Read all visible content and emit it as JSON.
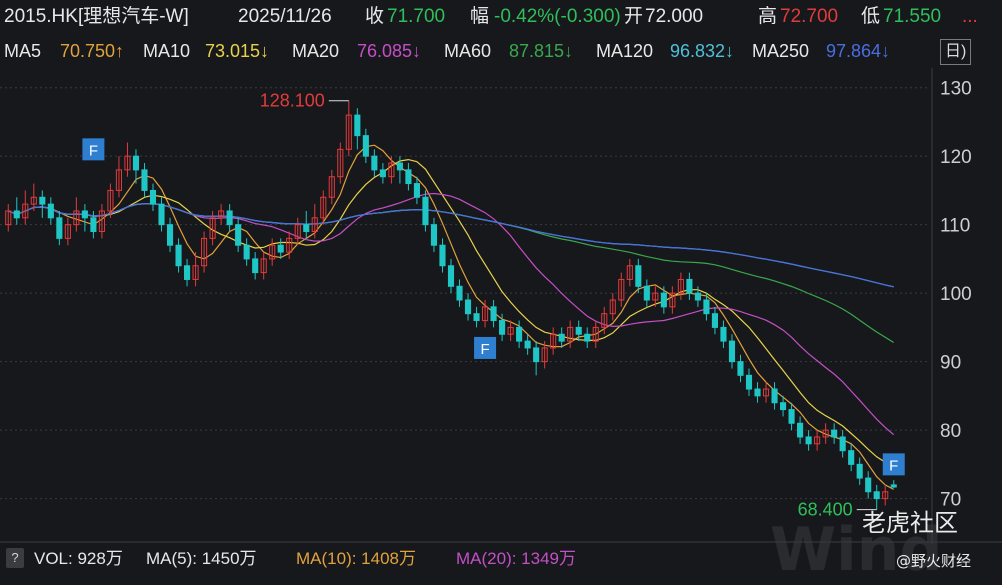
{
  "header": {
    "symbol": "2015.HK[理想汽车-W]",
    "date": "2025/11/26",
    "close_label": "收",
    "close": "71.700",
    "change_label": "幅",
    "change": "-0.42%(-0.300)",
    "open_label": "开",
    "open": "72.000",
    "high_label": "高",
    "high": "72.700",
    "low_label": "低",
    "low": "71.550",
    "more": "..."
  },
  "ma_row": [
    {
      "text": "MA5",
      "value": "70.750↑",
      "color": "#e1a23c"
    },
    {
      "text": "MA10",
      "value": "73.015↓",
      "color": "#e8d24a"
    },
    {
      "text": "MA20",
      "value": "76.085↓",
      "color": "#c44fc6"
    },
    {
      "text": "MA60",
      "value": "87.815↓",
      "color": "#39a74c"
    },
    {
      "text": "MA120",
      "value": "96.832↓",
      "color": "#4fc0d8"
    },
    {
      "text": "MA250",
      "value": "97.864↓",
      "color": "#4a6ee0"
    }
  ],
  "period_button": "日)",
  "volume_row": {
    "icon": "?",
    "vol": "VOL: 928万",
    "ma5": "MA(5): 1450万",
    "ma10": "MA(10): 1408万",
    "ma20": "MA(20): 1349万"
  },
  "watermark": {
    "brand": "老虎社区",
    "author": "@野火财经",
    "bg_text": "Wind"
  },
  "colors": {
    "up": "#e23b3b",
    "down": "#1fc6c6",
    "axis_text": "#cfcfcf",
    "grid": "#3a3b40",
    "high_label": "#e23b3b",
    "low_label": "#2fbf5a",
    "flag": "#2f7fd0"
  },
  "chart_data": {
    "type": "candlestick",
    "yticks": [
      70,
      80,
      90,
      100,
      110,
      120,
      130
    ],
    "ylim": [
      66,
      132
    ],
    "annotations": {
      "high": "128.100",
      "low": "68.400",
      "event_flag": "F"
    },
    "candles": [
      [
        110,
        112,
        109,
        113
      ],
      [
        112,
        111,
        110,
        114
      ],
      [
        111,
        113,
        110,
        115
      ],
      [
        113,
        114,
        112,
        116
      ],
      [
        114,
        113,
        111,
        115
      ],
      [
        113,
        111,
        110,
        114
      ],
      [
        111,
        108,
        107,
        112
      ],
      [
        108,
        110,
        107,
        111
      ],
      [
        110,
        112,
        109,
        114
      ],
      [
        112,
        111,
        109,
        113
      ],
      [
        111,
        109,
        108,
        112
      ],
      [
        109,
        112,
        108,
        113
      ],
      [
        112,
        115,
        111,
        116
      ],
      [
        115,
        118,
        114,
        120
      ],
      [
        118,
        120,
        117,
        122
      ],
      [
        120,
        118,
        116,
        121
      ],
      [
        118,
        115,
        114,
        119
      ],
      [
        115,
        113,
        112,
        116
      ],
      [
        113,
        110,
        109,
        114
      ],
      [
        110,
        107,
        106,
        111
      ],
      [
        107,
        104,
        103,
        108
      ],
      [
        104,
        102,
        101,
        105
      ],
      [
        102,
        104,
        101,
        106
      ],
      [
        104,
        108,
        103,
        109
      ],
      [
        108,
        111,
        107,
        112
      ],
      [
        111,
        112,
        110,
        113
      ],
      [
        112,
        110,
        109,
        113
      ],
      [
        110,
        107,
        106,
        111
      ],
      [
        107,
        105,
        104,
        108
      ],
      [
        105,
        103,
        102,
        106
      ],
      [
        103,
        105,
        102,
        106
      ],
      [
        105,
        107,
        104,
        108
      ],
      [
        107,
        106,
        105,
        108
      ],
      [
        106,
        108,
        105,
        109
      ],
      [
        108,
        110,
        107,
        111
      ],
      [
        110,
        109,
        108,
        112
      ],
      [
        109,
        111,
        108,
        113
      ],
      [
        111,
        114,
        110,
        115
      ],
      [
        114,
        117,
        113,
        118
      ],
      [
        117,
        121,
        116,
        122
      ],
      [
        121,
        126,
        120,
        128.1
      ],
      [
        126,
        123,
        121,
        127
      ],
      [
        123,
        120,
        119,
        124
      ],
      [
        120,
        118,
        117,
        121
      ],
      [
        118,
        117,
        116,
        119
      ],
      [
        117,
        119,
        116,
        120
      ],
      [
        119,
        118,
        116,
        120
      ],
      [
        118,
        116,
        115,
        119
      ],
      [
        116,
        114,
        113,
        117
      ],
      [
        114,
        110,
        109,
        115
      ],
      [
        110,
        107,
        106,
        111
      ],
      [
        107,
        104,
        103,
        108
      ],
      [
        104,
        101,
        100,
        105
      ],
      [
        101,
        99,
        98,
        102
      ],
      [
        99,
        97,
        96,
        100
      ],
      [
        97,
        96,
        95,
        98
      ],
      [
        96,
        98,
        95,
        99
      ],
      [
        98,
        96,
        95,
        99
      ],
      [
        96,
        94,
        93,
        97
      ],
      [
        94,
        95,
        93,
        96
      ],
      [
        95,
        93,
        92,
        96
      ],
      [
        93,
        92,
        91,
        94
      ],
      [
        92,
        90,
        88,
        93
      ],
      [
        90,
        92,
        89,
        93
      ],
      [
        92,
        94,
        91,
        95
      ],
      [
        94,
        93,
        92,
        95
      ],
      [
        93,
        95,
        92,
        96
      ],
      [
        95,
        94,
        93,
        96
      ],
      [
        94,
        93,
        92,
        95
      ],
      [
        93,
        95,
        92,
        96
      ],
      [
        95,
        97,
        94,
        98
      ],
      [
        97,
        99,
        96,
        100
      ],
      [
        99,
        102,
        98,
        103
      ],
      [
        102,
        104,
        101,
        105
      ],
      [
        104,
        101,
        100,
        105
      ],
      [
        101,
        99,
        98,
        102
      ],
      [
        99,
        100,
        98,
        101
      ],
      [
        100,
        98,
        97,
        101
      ],
      [
        98,
        100,
        97,
        101
      ],
      [
        100,
        102,
        99,
        103
      ],
      [
        102,
        100,
        99,
        103
      ],
      [
        100,
        99,
        98,
        101
      ],
      [
        99,
        97,
        96,
        100
      ],
      [
        97,
        95,
        94,
        98
      ],
      [
        95,
        93,
        92,
        96
      ],
      [
        93,
        90,
        89,
        94
      ],
      [
        90,
        88,
        87,
        91
      ],
      [
        88,
        86,
        85,
        89
      ],
      [
        86,
        85,
        84,
        87
      ],
      [
        85,
        86,
        84,
        87
      ],
      [
        86,
        84,
        83,
        87
      ],
      [
        84,
        83,
        82,
        85
      ],
      [
        83,
        81,
        80,
        84
      ],
      [
        81,
        79,
        78,
        82
      ],
      [
        79,
        78,
        77,
        80
      ],
      [
        78,
        79,
        77,
        80
      ],
      [
        79,
        80,
        78,
        81
      ],
      [
        80,
        79,
        78,
        81
      ],
      [
        79,
        77,
        76,
        80
      ],
      [
        77,
        75,
        74,
        78
      ],
      [
        75,
        73,
        72,
        76
      ],
      [
        73,
        71,
        70,
        74
      ],
      [
        71,
        70,
        68.4,
        72
      ],
      [
        70,
        71,
        69,
        72
      ],
      [
        72,
        71.7,
        71.55,
        72.7
      ]
    ],
    "ma_series": [
      {
        "name": "MA5",
        "period": 5
      },
      {
        "name": "MA10",
        "period": 10
      },
      {
        "name": "MA20",
        "period": 20
      },
      {
        "name": "MA60",
        "period": 60
      },
      {
        "name": "MA120",
        "period": 120
      },
      {
        "name": "MA250",
        "period": 250
      }
    ]
  }
}
